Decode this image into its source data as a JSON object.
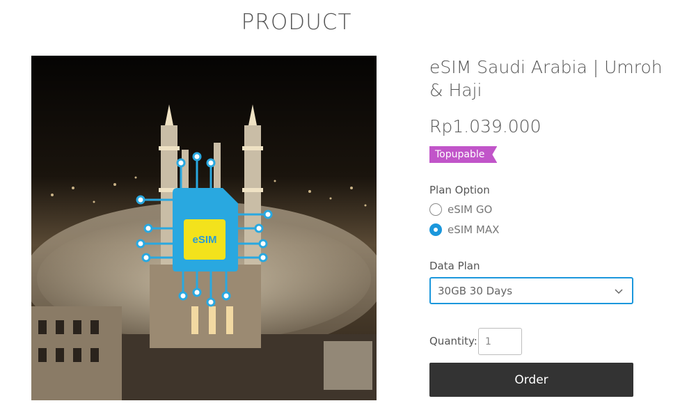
{
  "page": {
    "heading": "PRODUCT"
  },
  "product": {
    "title": "eSIM Saudi Arabia | Umroh & Haji",
    "price": "Rp1.039.000",
    "badge": "Topupable",
    "image": {
      "chip_label": "eSIM",
      "description_icon": "esim-card-icon"
    }
  },
  "plan_option": {
    "label": "Plan Option",
    "options": [
      {
        "label": "eSIM GO",
        "selected": false
      },
      {
        "label": "eSIM MAX",
        "selected": true
      }
    ]
  },
  "data_plan": {
    "label": "Data Plan",
    "selected": "30GB 30 Days",
    "icon": "chevron-down-icon"
  },
  "quantity": {
    "label": "Quantity:",
    "value": "1"
  },
  "order": {
    "label": "Order"
  },
  "colors": {
    "accent": "#1b97dc",
    "badge": "#c155c9",
    "button": "#333333",
    "esim_card": "#29a8e0",
    "esim_chip": "#f3e21c"
  }
}
